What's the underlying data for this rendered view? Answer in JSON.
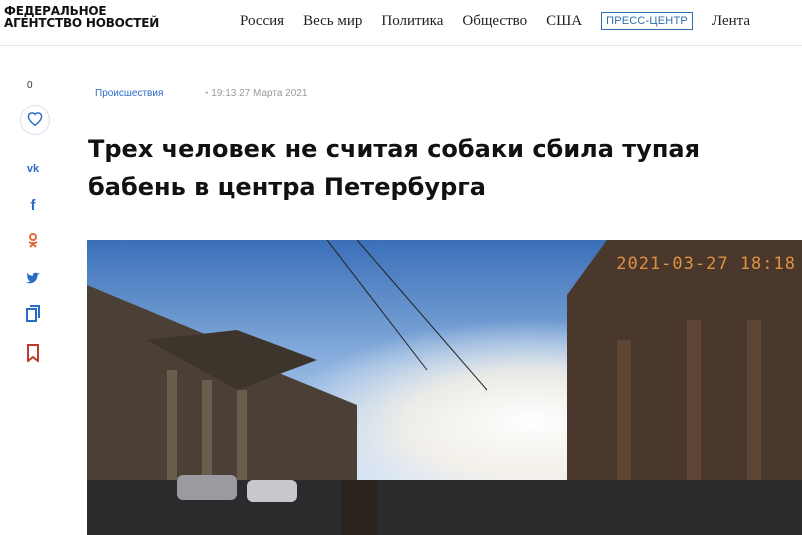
{
  "header": {
    "logo_line1": "ФЕДЕРАЛЬНОЕ",
    "logo_line2": "АГЕНТСТВО НОВОСТЕЙ",
    "nav": [
      "Россия",
      "Весь мир",
      "Политика",
      "Общество",
      "США",
      "ПРЕСС-ЦЕНТР",
      "Лента"
    ]
  },
  "sidebar": {
    "likes_count": "0",
    "share_icons": [
      "vk-icon",
      "facebook-icon",
      "odnoklassniki-icon",
      "twitter-icon",
      "copy-icon",
      "bookmark-icon"
    ]
  },
  "article": {
    "category": "Происшествия",
    "time": "19:13",
    "date": "27 Марта 2021",
    "title_line1": "Трех человек не считая собаки сбила тупая",
    "title_line2": "бабень в центра Петербурга"
  },
  "photo": {
    "timestamp": "2021-03-27 18:18"
  },
  "colors": {
    "accent": "#2a6bc6",
    "press_border": "#2b6cb0",
    "timestamp": "#e09040"
  }
}
